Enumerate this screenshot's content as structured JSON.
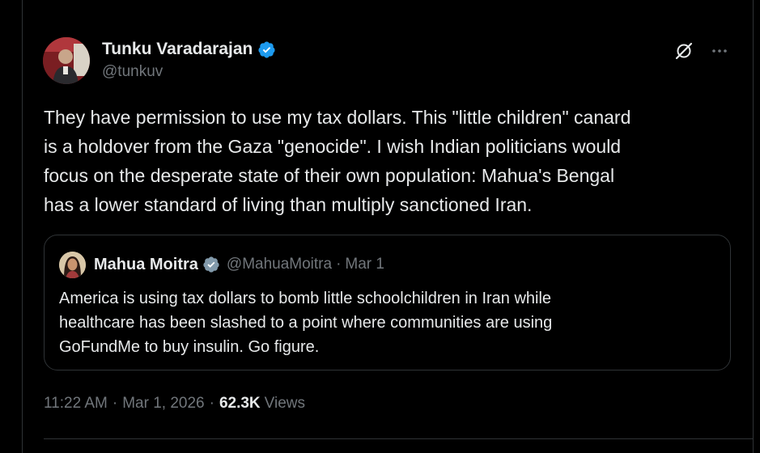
{
  "tweet": {
    "author": {
      "display_name": "Tunku Varadarajan",
      "handle": "@tunkuv",
      "verified": true,
      "avatar_icon": "profile-photo"
    },
    "text": "They have permission to use my tax dollars. This \"little children\" canard\nis a holdover from the Gaza \"genocide\".  I wish Indian politicians would\nfocus on the desperate state of their own population: Mahua's Bengal\nhas a lower standard of living than multiply sanctioned Iran.",
    "quote": {
      "display_name": "Mahua Moitra",
      "handle": "@MahuaMoitra",
      "separator": "·",
      "date": "Mar 1",
      "verified": true,
      "text": "America is using tax dollars to bomb little schoolchildren in Iran while\nhealthcare has been slashed to a point where communities are using\nGoFundMe to buy insulin.  Go figure."
    },
    "meta": {
      "time": "11:22 AM",
      "separator": "·",
      "date": "Mar 1, 2026",
      "views_count": "62.3K",
      "views_label": "Views"
    }
  },
  "icons": {
    "grok": "grok-icon",
    "more": "more-icon",
    "verified": "verified-badge-icon"
  },
  "colors": {
    "background": "#000000",
    "primary_text": "#e7e9ea",
    "secondary_text": "#71767b",
    "border": "#2f3336",
    "verified_blue": "#1d9bf0"
  }
}
